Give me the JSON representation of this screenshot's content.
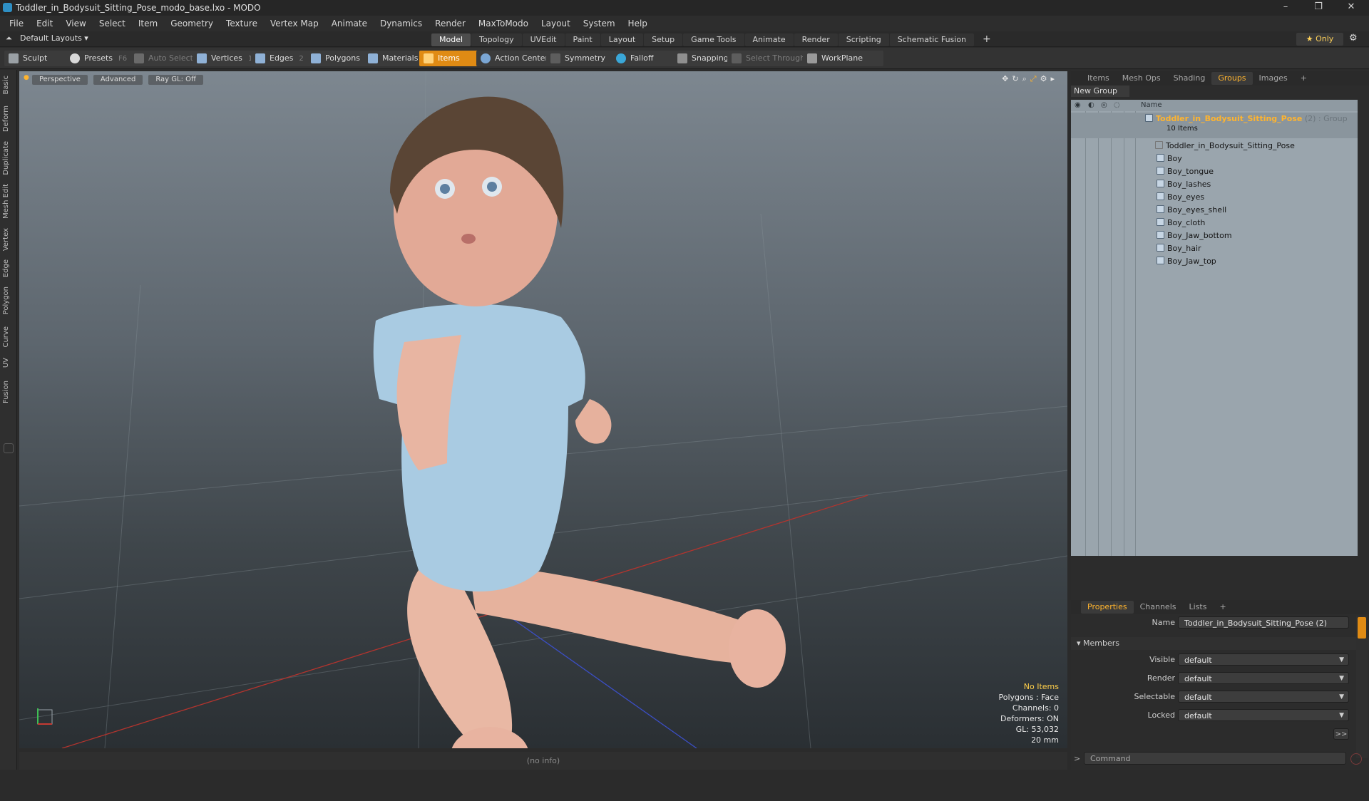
{
  "window": {
    "title": "Toddler_in_Bodysuit_Sitting_Pose_modo_base.lxo - MODO",
    "controls": [
      "–",
      "❐",
      "✕"
    ]
  },
  "menubar": [
    "File",
    "Edit",
    "View",
    "Select",
    "Item",
    "Geometry",
    "Texture",
    "Vertex Map",
    "Animate",
    "Dynamics",
    "Render",
    "MaxToModo",
    "Layout",
    "System",
    "Help"
  ],
  "layoutbar": {
    "layout_select": "Default Layouts ▾",
    "modes": [
      "Model",
      "Topology",
      "UVEdit",
      "Paint",
      "Layout",
      "Setup",
      "Game Tools",
      "Animate",
      "Render",
      "Scripting",
      "Schematic Fusion",
      "+"
    ],
    "active_mode": "Model",
    "only_label": "★ Only"
  },
  "toolbar": {
    "sculpt": "Sculpt",
    "presets": "Presets",
    "presets_key": "F6",
    "auto_select": "Auto Select",
    "vertices": "Vertices",
    "vertices_key": "1",
    "edges": "Edges",
    "edges_key": "2",
    "polygons": "Polygons",
    "materials": "Materials",
    "items": "Items",
    "action_center": "Action Center",
    "symmetry": "Symmetry",
    "falloff": "Falloff",
    "snapping": "Snapping",
    "select_through": "Select Through",
    "workplane": "WorkPlane"
  },
  "lefttabs": [
    "Basic",
    "Deform",
    "Duplicate",
    "Mesh Edit",
    "Vertex",
    "Edge",
    "Polygon",
    "Curve",
    "UV",
    "Fusion"
  ],
  "viewport": {
    "view": "Perspective",
    "shading": "Advanced",
    "raygl": "Ray GL: Off",
    "info": {
      "items": "No Items",
      "polygons": "Polygons : Face",
      "channels": "Channels: 0",
      "deformers": "Deformers: ON",
      "gl": "GL: 53,032",
      "unit": "20 mm"
    }
  },
  "rightpanel": {
    "tabs": [
      "Items",
      "Mesh Ops",
      "Shading",
      "Groups",
      "Images",
      "+"
    ],
    "active_tab": "Groups",
    "new_group": "New Group",
    "column_name": "Name",
    "group_name": "Toddler_in_Bodysuit_Sitting_Pose",
    "group_meta": "(2) : Group",
    "group_count": "10 Items",
    "members": [
      "Toddler_in_Bodysuit_Sitting_Pose",
      "Boy",
      "Boy_tongue",
      "Boy_lashes",
      "Boy_eyes",
      "Boy_eyes_shell",
      "Boy_cloth",
      "Boy_Jaw_bottom",
      "Boy_hair",
      "Boy_Jaw_top"
    ]
  },
  "properties": {
    "tabs": [
      "Properties",
      "Channels",
      "Lists",
      "+"
    ],
    "active_tab": "Properties",
    "name_label": "Name",
    "name_value": "Toddler_in_Bodysuit_Sitting_Pose (2)",
    "members_header": "Members",
    "visible_label": "Visible",
    "visible_value": "default",
    "render_label": "Render",
    "render_value": "default",
    "selectable_label": "Selectable",
    "selectable_value": "default",
    "locked_label": "Locked",
    "locked_value": "default",
    "more_button": ">>"
  },
  "statusbar": {
    "info": "(no info)"
  },
  "command": {
    "placeholder": "Command"
  }
}
